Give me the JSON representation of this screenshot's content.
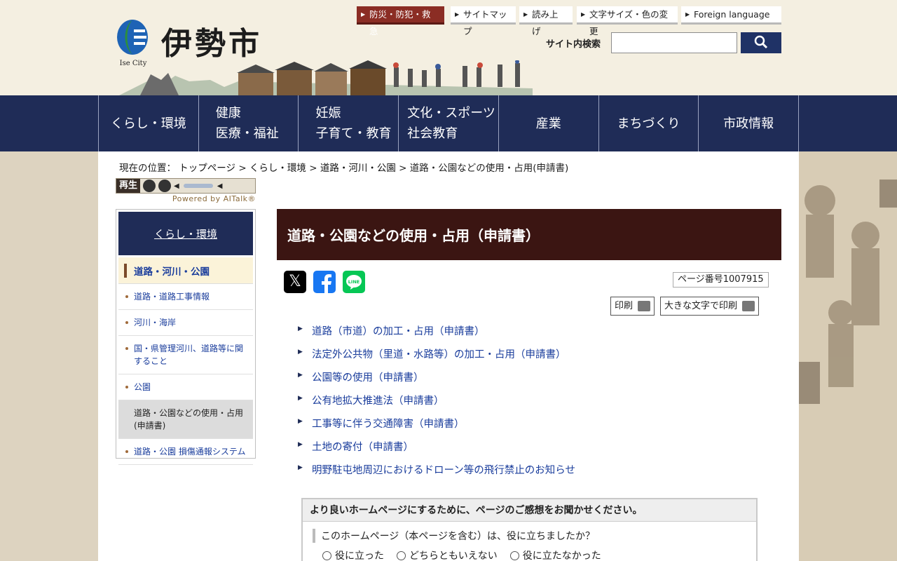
{
  "header": {
    "logo_text": "伊勢市",
    "logo_sub": "Ise City",
    "util_links": [
      {
        "label": "防災・防犯・救急"
      },
      {
        "label": "サイトマップ"
      },
      {
        "label": "読み上げ"
      },
      {
        "label": "文字サイズ・色の変更"
      },
      {
        "label": "Foreign language"
      }
    ],
    "search_label": "サイト内検索",
    "search_value": ""
  },
  "gnav": [
    {
      "lines": [
        "くらし・環境"
      ]
    },
    {
      "lines": [
        "健康",
        "医療・福祉"
      ]
    },
    {
      "lines": [
        "妊娠",
        "子育て・教育"
      ]
    },
    {
      "lines": [
        "文化・スポーツ",
        "社会教育"
      ]
    },
    {
      "lines": [
        "産業"
      ]
    },
    {
      "lines": [
        "まちづくり"
      ]
    },
    {
      "lines": [
        "市政情報"
      ]
    }
  ],
  "breadcrumb": {
    "prefix": "現在の位置：",
    "items": [
      "トップページ",
      "くらし・環境",
      "道路・河川・公園"
    ],
    "sep": ">",
    "current": "道路・公園などの使用・占用(申請書)"
  },
  "player": {
    "play_label": "再生",
    "powered": "Powered by AITalk®"
  },
  "sidebar": {
    "heading": "くらし・環境",
    "current": "道路・河川・公園",
    "items": [
      {
        "label": "道路・道路工事情報"
      },
      {
        "label": "河川・海岸"
      },
      {
        "label": "国・県管理河川、道路等に関すること"
      },
      {
        "label": "公園"
      },
      {
        "label": "道路・公園などの使用・占用(申請書)"
      },
      {
        "label": "道路・公園 損傷通報システム"
      }
    ]
  },
  "main": {
    "title": "道路・公園などの使用・占用（申請書）",
    "page_number": "ページ番号1007915",
    "print_label": "印刷",
    "print_large_label": "大きな文字で印刷",
    "links": [
      "道路（市道）の加工・占用（申請書）",
      "法定外公共物（里道・水路等）の加工・占用（申請書）",
      "公園等の使用（申請書）",
      "公有地拡大推進法（申請書）",
      "工事等に伴う交通障害（申請書）",
      "土地の寄付（申請書）",
      "明野駐屯地周辺におけるドローン等の飛行禁止のお知らせ"
    ]
  },
  "survey": {
    "heading": "より良いホームページにするために、ページのご感想をお聞かせください。",
    "question": "このホームページ（本ページを含む）は、役に立ちましたか？",
    "options": [
      "役に立った",
      "どちらともいえない",
      "役に立たなかった"
    ]
  },
  "colors": {
    "nav": "#1f2c57",
    "title_bg": "#3b1512",
    "disaster": "#8b2d24",
    "link": "#1a3d9c"
  }
}
